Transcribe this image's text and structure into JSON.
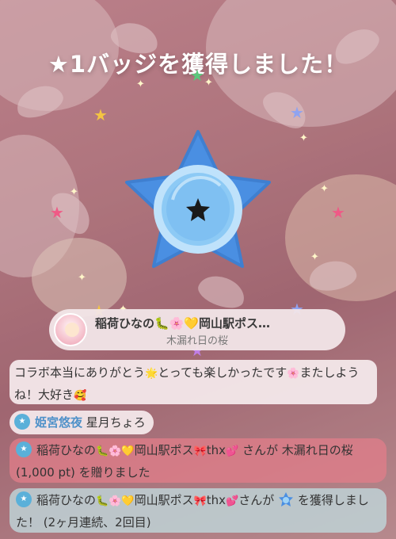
{
  "overlay": {
    "headline": "★1バッジを獲得しました！"
  },
  "badge": {
    "icon": "star-badge-icon",
    "colors": {
      "outer": "#4a8fe2",
      "ring": "#bfe2fb",
      "inner": "#7fc0f2",
      "star": "#1a1a1a"
    }
  },
  "streamer_card": {
    "name": "稲荷ひなの🐛🌸💛岡山駅ポス…",
    "subtitle": "木漏れ日の桜"
  },
  "chat": {
    "message1": {
      "text_part1": "コラボ本当にありがとう",
      "emoji1": "🌟",
      "text_part2": "とっても楽しかったです",
      "emoji2": "🌸",
      "text_part3": "またしようね！大好き",
      "emoji3": "🥰"
    },
    "message2": {
      "user": "姫宮悠夜",
      "text": "星月ちょろ"
    },
    "message3": {
      "user": "稲荷ひなの",
      "emojis": "🐛🌸💛",
      "user_rest": "岡山駅ポス",
      "emojis2": "🎀",
      "user_tail": "thx",
      "emoji_heart": "💕",
      "text": " さんが 木漏れ日の桜 (1,000 pt) を贈りました"
    },
    "message4": {
      "user": "稲荷ひなの",
      "emojis": "🐛🌸💛",
      "user_rest": "岡山駅ポス",
      "emojis2": "🎀",
      "user_tail": "thx",
      "emoji_heart": "💕",
      "text_before_badge": "さんが",
      "text_after_badge": "を獲得しました！ (2ヶ月連続、2回目)"
    }
  }
}
